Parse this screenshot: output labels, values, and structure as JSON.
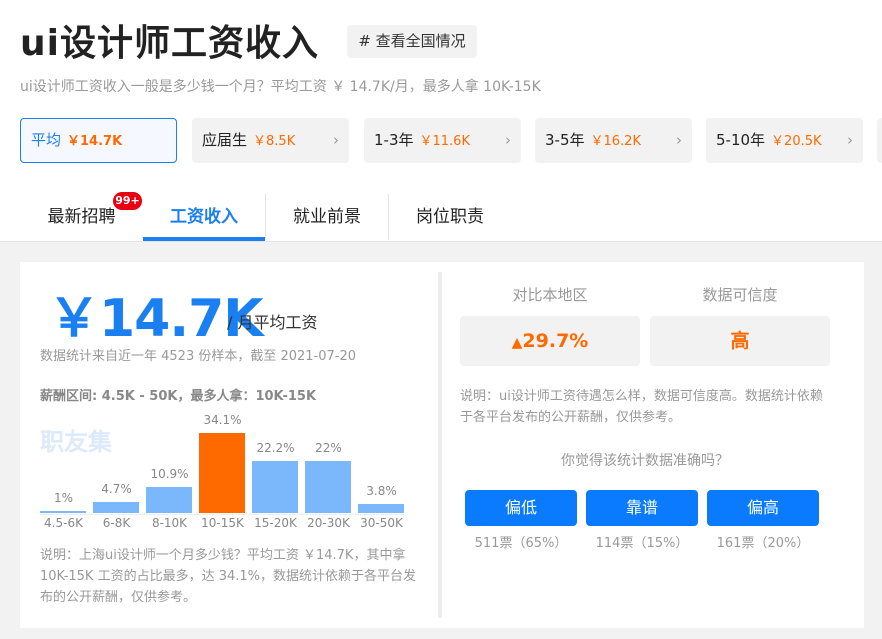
{
  "header": {
    "title": "ui设计师工资收入",
    "tag": "# 查看全国情况",
    "subtitle": "ui设计师工资收入一般是多少钱一个月？平均工资 ￥ 14.7K/月，最多人拿 10K-15K"
  },
  "experience_cards": [
    {
      "label": "平均",
      "value": "￥14.7K"
    },
    {
      "label": "应届生",
      "value": "￥8.5K"
    },
    {
      "label": "1-3年",
      "value": "￥11.6K"
    },
    {
      "label": "3-5年",
      "value": "￥16.2K"
    },
    {
      "label": "5-10年",
      "value": "￥20.5K"
    }
  ],
  "tabs": [
    {
      "label": "最新招聘",
      "badge": "99+"
    },
    {
      "label": "工资收入"
    },
    {
      "label": "就业前景"
    },
    {
      "label": "岗位职责"
    }
  ],
  "salary": {
    "amount": "￥14.7K",
    "unit": "/ 月平均工资",
    "stat": "数据统计来自近一年 4523 份样本，截至 2021-07-20",
    "range": "薪酬区间: 4.5K - 50K，最多人拿：10K-15K",
    "watermark": "职友集",
    "note": "说明：上海ui设计师一个月多少钱？平均工资 ￥14.7K，其中拿 10K-15K 工资的占比最多，达 34.1%，数据统计依赖于各平台发布的公开薪酬，仅供参考。"
  },
  "chart_data": {
    "type": "bar",
    "categories": [
      "4.5-6K",
      "6-8K",
      "8-10K",
      "10-15K",
      "15-20K",
      "20-30K",
      "30-50K"
    ],
    "values": [
      1,
      4.7,
      10.9,
      34.1,
      22.2,
      22,
      3.8
    ],
    "labels": [
      "1%",
      "4.7%",
      "10.9%",
      "34.1%",
      "22.2%",
      "22%",
      "3.8%"
    ],
    "highlight_index": 3,
    "colors": {
      "normal": "#7ab8fb",
      "highlight": "#ff6a00"
    }
  },
  "compare": {
    "region_label": "对比本地区",
    "region_value": "29.7%",
    "trust_label": "数据可信度",
    "trust_value": "高",
    "note": "说明：ui设计师工资待遇怎么样，数据可信度高。数据统计依赖于各平台发布的公开薪酬，仅供参考。",
    "question": "你觉得该统计数据准确吗？",
    "votes": [
      {
        "label": "偏低",
        "count": "511票（65%）"
      },
      {
        "label": "靠谱",
        "count": "114票（15%）"
      },
      {
        "label": "偏高",
        "count": "161票（20%）"
      }
    ]
  }
}
